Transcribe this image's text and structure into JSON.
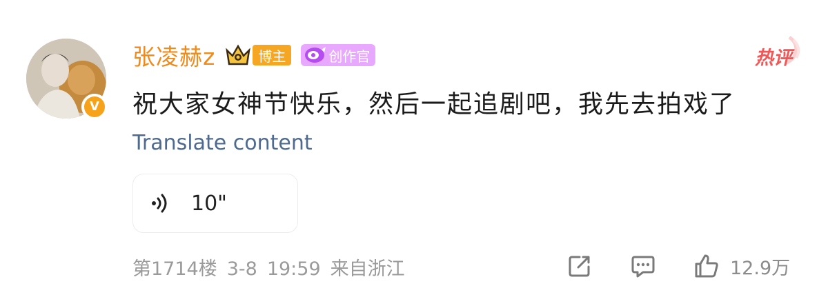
{
  "user": {
    "name": "张凌赫z",
    "badge_blogger": "博主",
    "badge_creator": "创作官",
    "verified_mark": "V"
  },
  "hot_label": "热评",
  "comment": {
    "text": "祝大家女神节快乐，然后一起追剧吧，我先去拍戏了",
    "translate": "Translate content"
  },
  "voice": {
    "duration": "10\""
  },
  "meta": {
    "floor": "第1714楼",
    "date": "3-8",
    "time": "19:59",
    "location": "来自浙江"
  },
  "actions": {
    "like_count": "12.9万"
  },
  "colors": {
    "username": "#f08a1a",
    "hot": "#f25757",
    "link": "#4f6a8f",
    "meta": "#9a9a9a"
  },
  "icons": [
    "avatar-photo",
    "verified-v-icon",
    "crown-icon",
    "creator-badge-icon",
    "hot-flame-icon",
    "voice-wave-icon",
    "share-icon",
    "comment-icon",
    "like-icon"
  ]
}
